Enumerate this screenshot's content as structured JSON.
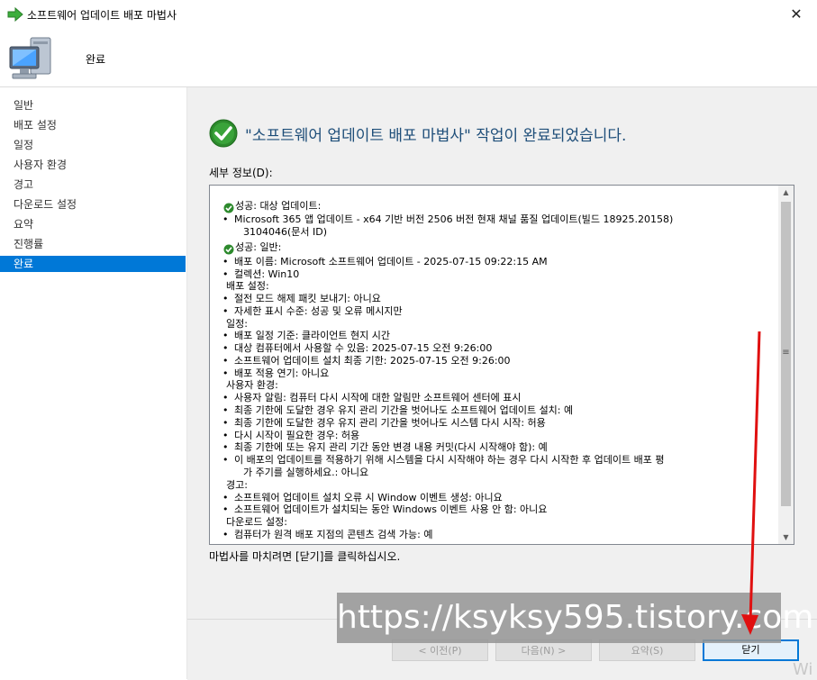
{
  "window": {
    "title": "소프트웨어 업데이트 배포 마법사",
    "close_symbol": "✕"
  },
  "header": {
    "page": "완료"
  },
  "sidebar": {
    "items": [
      {
        "label": "일반"
      },
      {
        "label": "배포 설정"
      },
      {
        "label": "일정"
      },
      {
        "label": "사용자 환경"
      },
      {
        "label": "경고"
      },
      {
        "label": "다운로드 설정"
      },
      {
        "label": "요약"
      },
      {
        "label": "진행률"
      },
      {
        "label": "완료",
        "selected": true
      }
    ]
  },
  "main": {
    "success_message": "\"소프트웨어 업데이트 배포 마법사\" 작업이 완료되었습니다.",
    "details_label": "세부 정보(D):",
    "details": [
      "성공: 대상 업데이트:",
      "Microsoft 365 앱 업데이트 - x64 기반 버전 2506 버전 현재 채널 품질 업데이트(빌드 18925.20158)",
      "3104046(문서 ID)",
      "성공: 일반:",
      "배포 이름: Microsoft 소프트웨어 업데이트 - 2025-07-15 09:22:15 AM",
      "컬렉션: Win10",
      "배포 설정:",
      "절전 모드 해제 패킷 보내기: 아니요",
      "자세한 표시 수준: 성공 및 오류 메시지만",
      "일정:",
      "배포 일정 기준: 클라이언트 현지 시간",
      "대상 컴퓨터에서 사용할 수 있음: 2025-07-15 오전 9:26:00",
      "소프트웨어 업데이트 설치 최종 기한: 2025-07-15 오전 9:26:00",
      "배포 적용 연기: 아니요",
      "사용자 환경:",
      "사용자 알림: 컴퓨터 다시 시작에 대한 알림만 소프트웨어 센터에 표시",
      "최종 기한에 도달한 경우 유지 관리 기간을 벗어나도 소프트웨어 업데이트 설치: 예",
      "최종 기한에 도달한 경우 유지 관리 기간을 벗어나도 시스템 다시 시작: 허용",
      "다시 시작이 필요한 경우: 허용",
      "최종 기한에 또는 유지 관리 기간 동안 변경 내용 커밋(다시 시작해야 함): 예",
      "이 배포의 업데이트를 적용하기 위해 시스템을 다시 시작해야 하는 경우 다시 시작한 후 업데이트 배포 평",
      "가 주기를 실행하세요.: 아니요",
      "경고:",
      "소프트웨어 업데이트 설치 오류 시 Window 이벤트 생성: 아니요",
      "소프트웨어 업데이트가 설치되는 동안 Windows 이벤트 사용 안 함: 아니요",
      "다운로드 설정:",
      "컴퓨터가 원격 배포 지점의 콘텐츠 검색 가능: 예"
    ],
    "finish_hint": "마법사를 마치려면 [닫기]를 클릭하십시오."
  },
  "footer": {
    "prev_label": "< 이전(P)",
    "next_label": "다음(N) >",
    "summary_label": "요약(S)",
    "close_label": "닫기"
  },
  "watermark": {
    "text": "https://ksyksy595.tistory.com"
  },
  "corner_text": "Wi",
  "colors": {
    "accent": "#0078d7",
    "success_green": "#2d8a2d",
    "annotation_red": "#e01010"
  }
}
